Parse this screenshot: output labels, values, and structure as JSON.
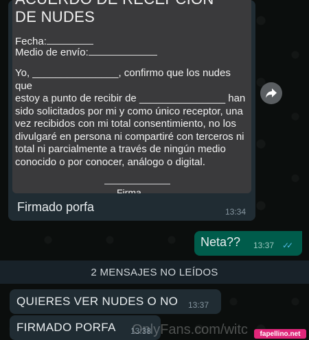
{
  "document": {
    "title_line1": "ACUERDO DE RECEPCION",
    "title_line2": "DE NUDES",
    "fecha_label": "Fecha:",
    "medio_label": "Medio de envío:",
    "body_line1": "Yo, _______________, confirmo que los nudes que",
    "body_line2": "estoy a punto de recibir de _______________ han",
    "body_line3": "sido solicitados por mi y como único receptor, una",
    "body_line4": "vez recibidos con mi total consentimiento, no los",
    "body_line5": "divulgaré en persona ni compartiré con terceros ni",
    "body_line6": "total ni parcialmente a través de ningún medio",
    "body_line7": "conocido o por conocer, análogo o digital.",
    "signature_label": "Firma"
  },
  "image_message": {
    "caption": "Firmado porfa",
    "time": "13:34"
  },
  "outgoing_message": {
    "text": "Neta??",
    "time": "13:37"
  },
  "unread_divider": "2 MENSAJES NO LEÍDOS",
  "incoming_messages": [
    {
      "text": "QUIERES VER NUDES O NO",
      "time": "13:37"
    },
    {
      "text": "FIRMADO PORFA",
      "time": "13:38"
    }
  ],
  "watermark": "OnlyFans.com/witc",
  "badge": "fapellino.net",
  "colors": {
    "background": "#0b0e0d",
    "incoming_bubble": "#202c33",
    "outgoing_bubble": "#005c4b",
    "read_ticks": "#53bdeb",
    "badge": "#e0267a"
  }
}
